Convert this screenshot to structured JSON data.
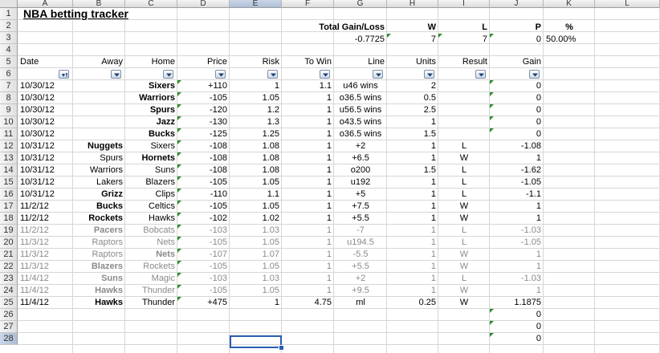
{
  "column_letters": [
    "A",
    "B",
    "C",
    "D",
    "E",
    "F",
    "G",
    "H",
    "I",
    "J",
    "K",
    "L"
  ],
  "row_numbers": [
    "1",
    "2",
    "3",
    "4",
    "5",
    "6",
    "7",
    "8",
    "9",
    "10",
    "11",
    "12",
    "13",
    "14",
    "15",
    "16",
    "17",
    "18",
    "19",
    "20",
    "21",
    "22",
    "23",
    "24",
    "25",
    "26",
    "27",
    "28"
  ],
  "title": "NBA betting tracker",
  "summary": {
    "total_label": "Total Gain/Loss",
    "total_value": "-0.7725",
    "w_label": "W",
    "w_value": "7",
    "l_label": "L",
    "l_value": "7",
    "p_label": "P",
    "p_value": "0",
    "pct_label": "%",
    "pct_value": "50.00%"
  },
  "headers": [
    "Date",
    "Away",
    "Home",
    "Price",
    "Risk",
    "To Win",
    "Line",
    "Units",
    "Result",
    "Gain"
  ],
  "rows": [
    {
      "date": "10/30/12",
      "away": "",
      "home": "Sixers",
      "price": "+110",
      "risk": "1",
      "towin": "1.1",
      "line": "u46 wins",
      "units": "2",
      "result": "",
      "gain": "0",
      "homeBold": true,
      "awayBold": false,
      "dim": false
    },
    {
      "date": "10/30/12",
      "away": "",
      "home": "Warriors",
      "price": "-105",
      "risk": "1.05",
      "towin": "1",
      "line": "o36.5 wins",
      "units": "0.5",
      "result": "",
      "gain": "0",
      "homeBold": true,
      "awayBold": false,
      "dim": false
    },
    {
      "date": "10/30/12",
      "away": "",
      "home": "Spurs",
      "price": "-120",
      "risk": "1.2",
      "towin": "1",
      "line": "u56.5 wins",
      "units": "2.5",
      "result": "",
      "gain": "0",
      "homeBold": true,
      "awayBold": false,
      "dim": false
    },
    {
      "date": "10/30/12",
      "away": "",
      "home": "Jazz",
      "price": "-130",
      "risk": "1.3",
      "towin": "1",
      "line": "o43.5 wins",
      "units": "1",
      "result": "",
      "gain": "0",
      "homeBold": true,
      "awayBold": false,
      "dim": false
    },
    {
      "date": "10/30/12",
      "away": "",
      "home": "Bucks",
      "price": "-125",
      "risk": "1.25",
      "towin": "1",
      "line": "o36.5 wins",
      "units": "1.5",
      "result": "",
      "gain": "0",
      "homeBold": true,
      "awayBold": false,
      "dim": false
    },
    {
      "date": "10/31/12",
      "away": "Nuggets",
      "home": "Sixers",
      "price": "-108",
      "risk": "1.08",
      "towin": "1",
      "line": "+2",
      "units": "1",
      "result": "L",
      "gain": "-1.08",
      "homeBold": false,
      "awayBold": true,
      "dim": false
    },
    {
      "date": "10/31/12",
      "away": "Spurs",
      "home": "Hornets",
      "price": "-108",
      "risk": "1.08",
      "towin": "1",
      "line": "+6.5",
      "units": "1",
      "result": "W",
      "gain": "1",
      "homeBold": true,
      "awayBold": false,
      "dim": false
    },
    {
      "date": "10/31/12",
      "away": "Warriors",
      "home": "Suns",
      "price": "-108",
      "risk": "1.08",
      "towin": "1",
      "line": "o200",
      "units": "1.5",
      "result": "L",
      "gain": "-1.62",
      "homeBold": false,
      "awayBold": false,
      "dim": false
    },
    {
      "date": "10/31/12",
      "away": "Lakers",
      "home": "Blazers",
      "price": "-105",
      "risk": "1.05",
      "towin": "1",
      "line": "u192",
      "units": "1",
      "result": "L",
      "gain": "-1.05",
      "homeBold": false,
      "awayBold": false,
      "dim": false
    },
    {
      "date": "10/31/12",
      "away": "Grizz",
      "home": "Clips",
      "price": "-110",
      "risk": "1.1",
      "towin": "1",
      "line": "+5",
      "units": "1",
      "result": "L",
      "gain": "-1.1",
      "homeBold": false,
      "awayBold": true,
      "dim": false
    },
    {
      "date": "11/2/12",
      "away": "Bucks",
      "home": "Celtics",
      "price": "-105",
      "risk": "1.05",
      "towin": "1",
      "line": "+7.5",
      "units": "1",
      "result": "W",
      "gain": "1",
      "homeBold": false,
      "awayBold": true,
      "dim": false
    },
    {
      "date": "11/2/12",
      "away": "Rockets",
      "home": "Hawks",
      "price": "-102",
      "risk": "1.02",
      "towin": "1",
      "line": "+5.5",
      "units": "1",
      "result": "W",
      "gain": "1",
      "homeBold": false,
      "awayBold": true,
      "dim": false
    },
    {
      "date": "11/2/12",
      "away": "Pacers",
      "home": "Bobcats",
      "price": "-103",
      "risk": "1.03",
      "towin": "1",
      "line": "-7",
      "units": "1",
      "result": "L",
      "gain": "-1.03",
      "homeBold": false,
      "awayBold": true,
      "dim": true
    },
    {
      "date": "11/3/12",
      "away": "Raptors",
      "home": "Nets",
      "price": "-105",
      "risk": "1.05",
      "towin": "1",
      "line": "u194.5",
      "units": "1",
      "result": "L",
      "gain": "-1.05",
      "homeBold": false,
      "awayBold": false,
      "dim": true
    },
    {
      "date": "11/3/12",
      "away": "Raptors",
      "home": "Nets",
      "price": "-107",
      "risk": "1.07",
      "towin": "1",
      "line": "-5.5",
      "units": "1",
      "result": "W",
      "gain": "1",
      "homeBold": true,
      "awayBold": false,
      "dim": true
    },
    {
      "date": "11/3/12",
      "away": "Blazers",
      "home": "Rockets",
      "price": "-105",
      "risk": "1.05",
      "towin": "1",
      "line": "+5.5",
      "units": "1",
      "result": "W",
      "gain": "1",
      "homeBold": false,
      "awayBold": true,
      "dim": true
    },
    {
      "date": "11/4/12",
      "away": "Suns",
      "home": "Magic",
      "price": "-103",
      "risk": "1.03",
      "towin": "1",
      "line": "+2",
      "units": "1",
      "result": "L",
      "gain": "-1.03",
      "homeBold": false,
      "awayBold": true,
      "dim": true
    },
    {
      "date": "11/4/12",
      "away": "Hawks",
      "home": "Thunder",
      "price": "-105",
      "risk": "1.05",
      "towin": "1",
      "line": "+9.5",
      "units": "1",
      "result": "W",
      "gain": "1",
      "homeBold": false,
      "awayBold": true,
      "dim": true
    },
    {
      "date": "11/4/12",
      "away": "Hawks",
      "home": "Thunder",
      "price": "+475",
      "risk": "1",
      "towin": "4.75",
      "line": "ml",
      "units": "0.25",
      "result": "W",
      "gain": "1.1875",
      "homeBold": false,
      "awayBold": true,
      "dim": false
    }
  ],
  "trailing_gain": [
    "0",
    "0",
    "0"
  ],
  "colors": {
    "selection": "#2a5fb0",
    "error_marker": "#2e8b2e",
    "dim_text": "#8a8a8a"
  }
}
